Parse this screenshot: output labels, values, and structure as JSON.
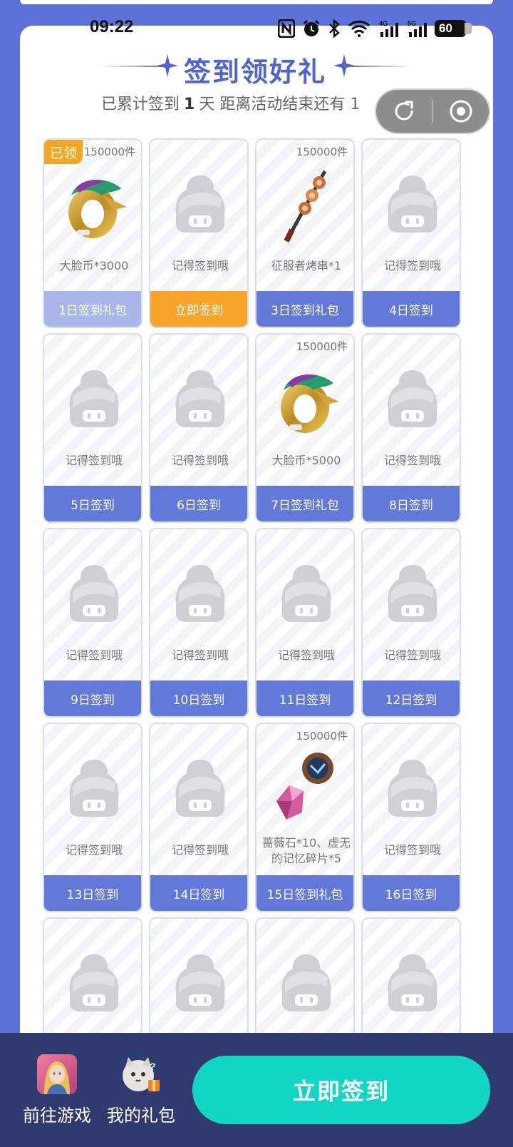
{
  "status_bar": {
    "time": "09:22",
    "battery": "60"
  },
  "header": {
    "title": "签到领好礼",
    "subtitle_prefix": "已累计签到",
    "days": "1",
    "subtitle_suffix": "天  距离活动结束还有 1"
  },
  "colors": {
    "accent": "#5d71d6",
    "active": "#f9a52a",
    "primary_cta": "#12d6c4"
  },
  "cards": [
    {
      "count": "150000件",
      "badge": "已领",
      "image": "gold-ring-icon",
      "desc": "大脸币*3000",
      "button": "1日签到礼包",
      "state": "claimed"
    },
    {
      "count": "",
      "badge": "",
      "image": "placeholder",
      "desc": "记得签到哦",
      "button": "立即签到",
      "state": "active"
    },
    {
      "count": "150000件",
      "badge": "",
      "image": "skewer-icon",
      "desc": "征服者烤串*1",
      "button": "3日签到礼包",
      "state": "normal"
    },
    {
      "count": "",
      "badge": "",
      "image": "placeholder",
      "desc": "记得签到哦",
      "button": "4日签到",
      "state": "normal"
    },
    {
      "count": "",
      "badge": "",
      "image": "placeholder",
      "desc": "记得签到哦",
      "button": "5日签到",
      "state": "normal"
    },
    {
      "count": "",
      "badge": "",
      "image": "placeholder",
      "desc": "记得签到哦",
      "button": "6日签到",
      "state": "normal"
    },
    {
      "count": "150000件",
      "badge": "",
      "image": "gold-ring-icon",
      "desc": "大脸币*5000",
      "button": "7日签到礼包",
      "state": "normal"
    },
    {
      "count": "",
      "badge": "",
      "image": "placeholder",
      "desc": "记得签到哦",
      "button": "8日签到",
      "state": "normal"
    },
    {
      "count": "",
      "badge": "",
      "image": "placeholder",
      "desc": "记得签到哦",
      "button": "9日签到",
      "state": "normal"
    },
    {
      "count": "",
      "badge": "",
      "image": "placeholder",
      "desc": "记得签到哦",
      "button": "10日签到",
      "state": "normal"
    },
    {
      "count": "",
      "badge": "",
      "image": "placeholder",
      "desc": "记得签到哦",
      "button": "11日签到",
      "state": "normal"
    },
    {
      "count": "",
      "badge": "",
      "image": "placeholder",
      "desc": "记得签到哦",
      "button": "12日签到",
      "state": "normal"
    },
    {
      "count": "",
      "badge": "",
      "image": "placeholder",
      "desc": "记得签到哦",
      "button": "13日签到",
      "state": "normal"
    },
    {
      "count": "",
      "badge": "",
      "image": "placeholder",
      "desc": "记得签到哦",
      "button": "14日签到",
      "state": "normal"
    },
    {
      "count": "150000件",
      "badge": "",
      "image": "crystal-icon",
      "desc": "蔷薇石*10、虚无的记忆碎片*5",
      "button": "15日签到礼包",
      "state": "normal"
    },
    {
      "count": "",
      "badge": "",
      "image": "placeholder",
      "desc": "记得签到哦",
      "button": "16日签到",
      "state": "normal"
    },
    {
      "count": "",
      "badge": "",
      "image": "placeholder",
      "desc": "",
      "button": "",
      "state": "normal"
    },
    {
      "count": "",
      "badge": "",
      "image": "placeholder",
      "desc": "",
      "button": "",
      "state": "normal"
    },
    {
      "count": "",
      "badge": "",
      "image": "placeholder",
      "desc": "",
      "button": "",
      "state": "normal"
    },
    {
      "count": "",
      "badge": "",
      "image": "placeholder",
      "desc": "",
      "button": "",
      "state": "normal"
    }
  ],
  "bottom_bar": {
    "game_label": "前往游戏",
    "gift_label": "我的礼包",
    "signin_label": "立即签到"
  }
}
